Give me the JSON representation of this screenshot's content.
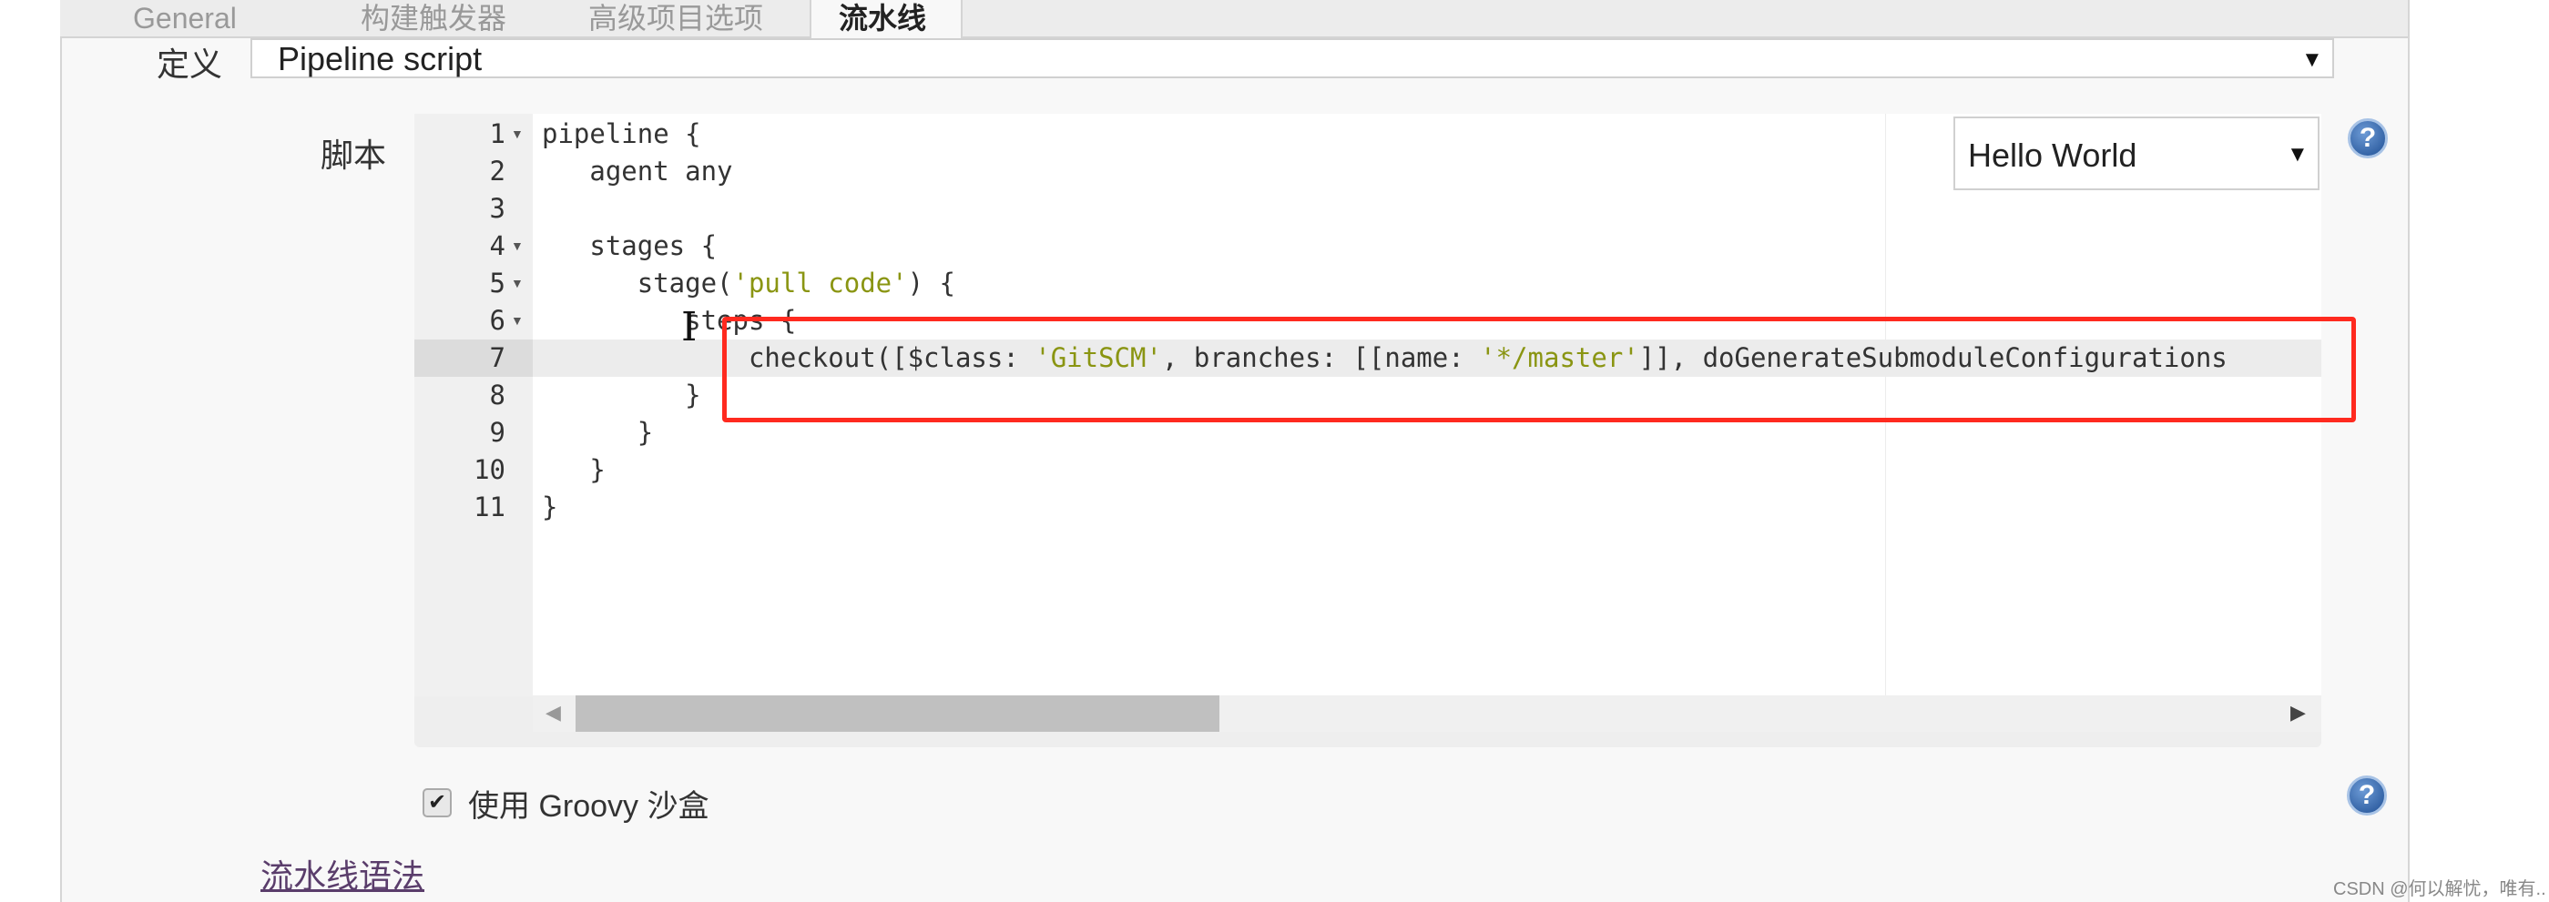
{
  "tabs": [
    {
      "label": "General"
    },
    {
      "label": "构建触发器"
    },
    {
      "label": "高级项目选项"
    },
    {
      "label": "流水线"
    }
  ],
  "definition": {
    "label": "定义",
    "value": "Pipeline script"
  },
  "script": {
    "label": "脚本",
    "template_select": "Hello World",
    "lines": [
      {
        "n": "1",
        "text": "pipeline {",
        "fold": true
      },
      {
        "n": "2",
        "text": "   agent any"
      },
      {
        "n": "3",
        "text": ""
      },
      {
        "n": "4",
        "text": "   stages {",
        "fold": true
      },
      {
        "n": "5",
        "pre": "      stage(",
        "str": "'pull code'",
        "post": ") {",
        "fold": true
      },
      {
        "n": "6",
        "text": "         steps {",
        "fold": true
      },
      {
        "n": "7",
        "pre": "             checkout([$class: ",
        "str": "'GitSCM'",
        "post": ", branches: [[name: ",
        "str2": "'*/master'",
        "post2": "]], doGenerateSubmoduleConfigurations",
        "active": true
      },
      {
        "n": "8",
        "text": "         }"
      },
      {
        "n": "9",
        "text": "      }"
      },
      {
        "n": "10",
        "text": "   }"
      },
      {
        "n": "11",
        "text": "}"
      }
    ]
  },
  "sandbox": {
    "label": "使用 Groovy 沙盒",
    "checked": true
  },
  "syntax_link": "流水线语法",
  "watermark": "CSDN @何以解忧，唯有..",
  "colors": {
    "highlight_box": "#ff2a1f",
    "string": "#8a9512",
    "link": "#5a3d6b"
  }
}
